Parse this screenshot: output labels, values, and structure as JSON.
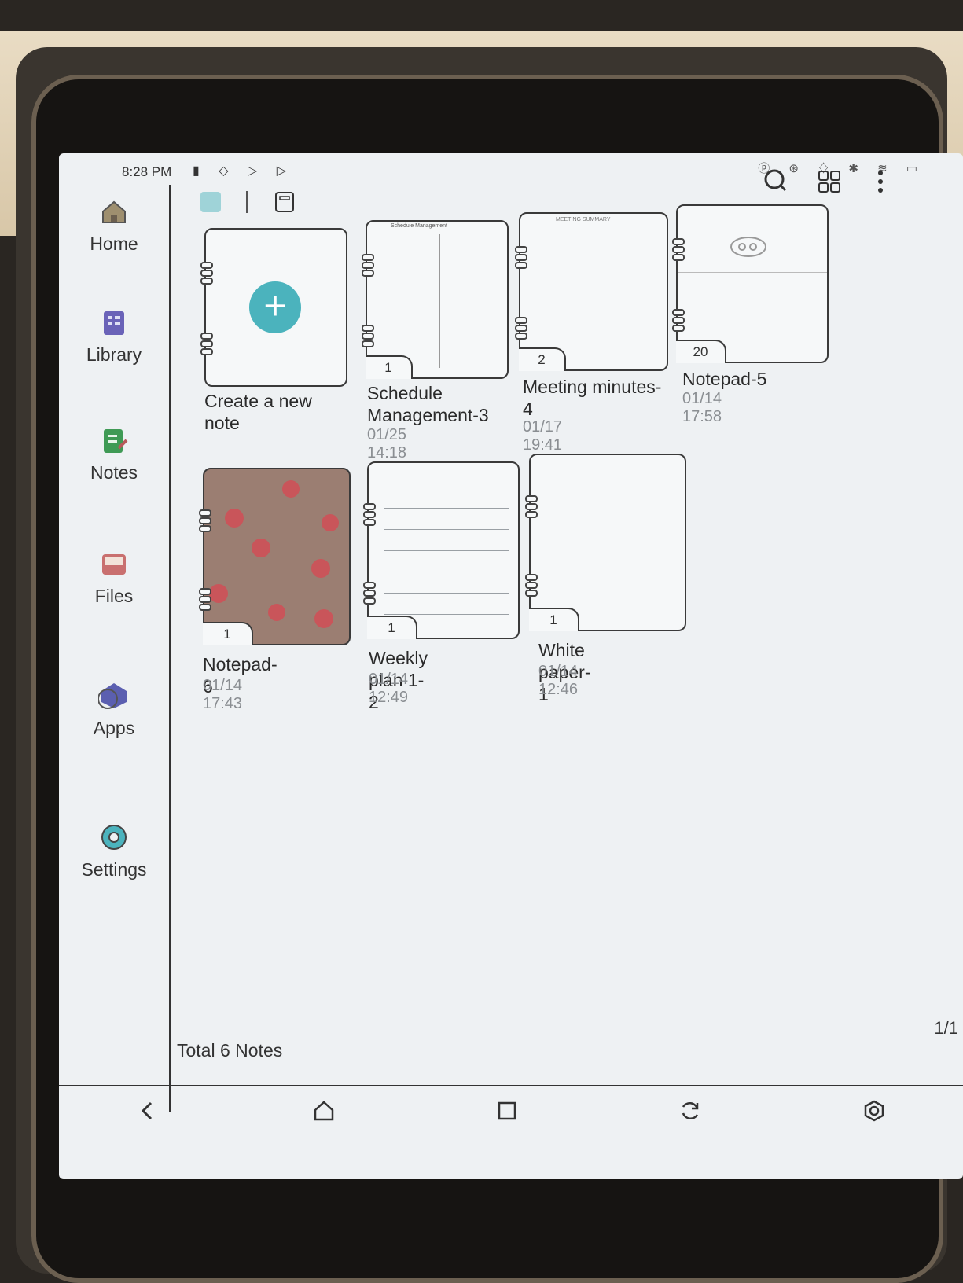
{
  "status_bar": {
    "time": "8:28 PM",
    "icons": [
      "battery-saver-icon",
      "shield-icon",
      "play-store-icon",
      "play-icon"
    ],
    "right_icons": [
      "pen-icon",
      "sync-icon",
      "bulb-icon",
      "bluetooth-icon",
      "wifi-icon",
      "battery-icon"
    ]
  },
  "sidebar": {
    "items": [
      {
        "label": "Home",
        "icon": "home-icon"
      },
      {
        "label": "Library",
        "icon": "library-icon"
      },
      {
        "label": "Notes",
        "icon": "notes-icon"
      },
      {
        "label": "Files",
        "icon": "files-icon"
      },
      {
        "label": "Apps",
        "icon": "apps-icon"
      },
      {
        "label": "Settings",
        "icon": "settings-icon"
      }
    ],
    "active": "Notes"
  },
  "toolbar": {
    "left_icons": [
      "color-note-icon",
      "notebook-view-icon"
    ],
    "right_icons": [
      "search-icon",
      "grid-view-icon",
      "more-icon"
    ]
  },
  "notes": [
    {
      "title": "Create a new note",
      "date": "",
      "pages": "",
      "type": "create"
    },
    {
      "title": "Schedule Management-3",
      "date": "01/25 14:18",
      "pages": "1",
      "type": "schedule",
      "header": "Schedule Management"
    },
    {
      "title": "Meeting minutes-4",
      "date": "01/17 19:41",
      "pages": "2",
      "type": "meeting",
      "header": "MEETING SUMMARY"
    },
    {
      "title": "Notepad-5",
      "date": "01/14 17:58",
      "pages": "20",
      "type": "sketch"
    },
    {
      "title": "Notepad-6",
      "date": "01/14 17:43",
      "pages": "1",
      "type": "pattern"
    },
    {
      "title": "Weekly plan 1-2",
      "date": "01/14 12:49",
      "pages": "1",
      "type": "lined"
    },
    {
      "title": "White paper-1",
      "date": "01/14 12:46",
      "pages": "1",
      "type": "blank"
    }
  ],
  "footer": {
    "total": "Total 6 Notes",
    "page": "1/1"
  },
  "nav_bar": [
    "back-icon",
    "home-nav-icon",
    "recents-icon",
    "refresh-icon",
    "e-ink-settings-icon"
  ],
  "colors": {
    "accent": "#4bb3bd",
    "pattern_bg": "#9b7e72",
    "fruit": "#c9555a"
  }
}
